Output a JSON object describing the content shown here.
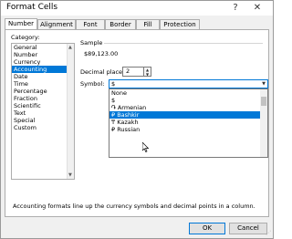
{
  "window": {
    "title": "Format Cells",
    "help_glyph": "?",
    "close_glyph": "✕"
  },
  "tabs": [
    {
      "label": "Number",
      "active": true
    },
    {
      "label": "Alignment",
      "active": false
    },
    {
      "label": "Font",
      "active": false
    },
    {
      "label": "Border",
      "active": false
    },
    {
      "label": "Fill",
      "active": false
    },
    {
      "label": "Protection",
      "active": false
    }
  ],
  "category": {
    "label": "Category:",
    "items": [
      "General",
      "Number",
      "Currency",
      "Accounting",
      "Date",
      "Time",
      "Percentage",
      "Fraction",
      "Scientific",
      "Text",
      "Special",
      "Custom"
    ],
    "selected": "Accounting"
  },
  "sample": {
    "label": "Sample",
    "value": "$89,123.00"
  },
  "decimal_places": {
    "label": "Decimal places:",
    "value": "2"
  },
  "symbol": {
    "label": "Symbol:",
    "value": "$",
    "options": [
      "None",
      "$",
      "֏ Armenian",
      "₽ Bashkir",
      "₸ Kazakh",
      "₽ Russian"
    ],
    "highlighted": "₽ Bashkir"
  },
  "description": "Accounting formats line up the currency symbols and decimal points in a column.",
  "buttons": {
    "ok": "OK",
    "cancel": "Cancel"
  },
  "colors": {
    "selection": "#0078d7",
    "dialog_bg": "#f0f0f0"
  },
  "icons": {
    "scroll_up": "scroll-up-icon",
    "scroll_down": "scroll-down-icon",
    "cursor": "mouse-pointer-icon"
  }
}
